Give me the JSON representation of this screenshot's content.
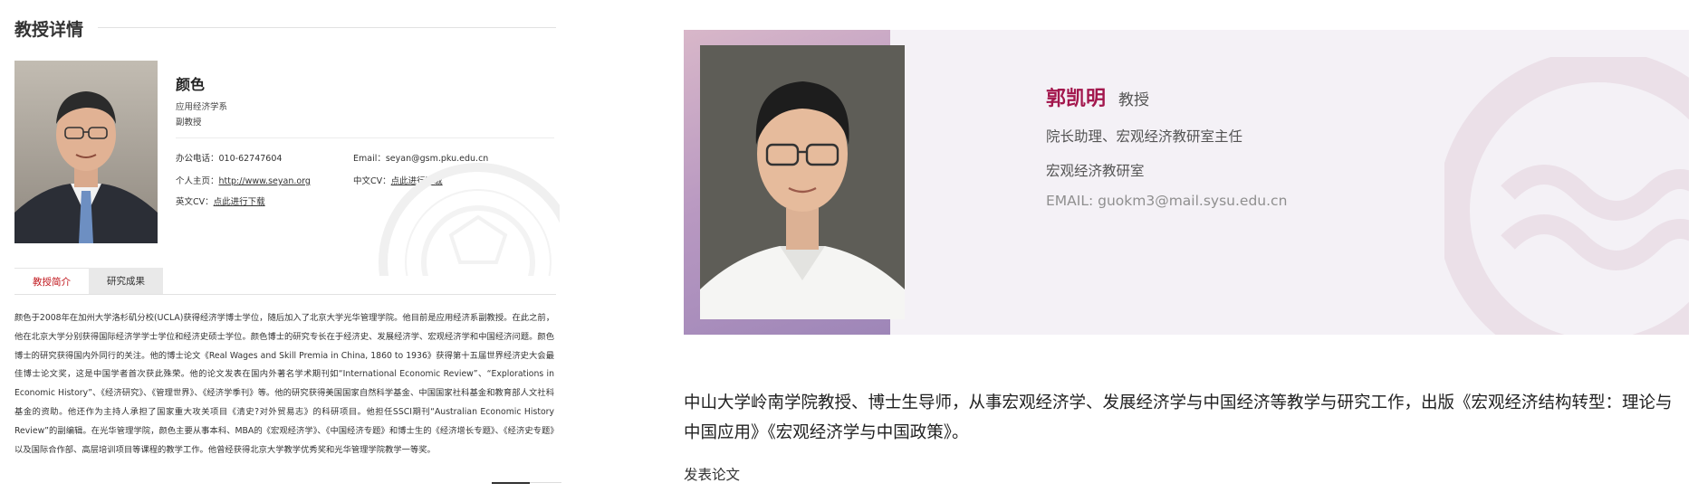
{
  "left": {
    "section_title": "教授详情",
    "professor": {
      "name": "颜色",
      "department": "应用经济学系",
      "title": "副教授"
    },
    "contact": {
      "phone_label": "办公电话：",
      "phone": "010-62747604",
      "email_label": "Email：",
      "email": "seyan@gsm.pku.edu.cn",
      "homepage_label": "个人主页：",
      "homepage": "http://www.seyan.org",
      "cv_cn_label": "中文CV：",
      "cv_cn_link": "点此进行下载",
      "cv_en_label": "英文CV：",
      "cv_en_link": "点此进行下载"
    },
    "tabs": [
      "教授简介",
      "研究成果"
    ],
    "bio": "颜色于2008年在加州大学洛杉矶分校(UCLA)获得经济学博士学位，随后加入了北京大学光华管理学院。他目前是应用经济系副教授。在此之前，他在北京大学分别获得国际经济学学士学位和经济史硕士学位。颜色博士的研究专长在于经济史、发展经济学、宏观经济学和中国经济问题。颜色博士的研究获得国内外同行的关注。他的博士论文《Real Wages and Skill Premia in China, 1860 to 1936》获得第十五届世界经济史大会最佳博士论文奖，这是中国学者首次获此殊荣。他的论文发表在国内外著名学术期刊如“International Economic Review”、“Explorations in Economic History”、《经济研究》、《管理世界》、《经济学季刊》等。他的研究获得美国国家自然科学基金、中国国家社科基金和教育部人文社科基金的资助。他还作为主持人承担了国家重大攻关项目《清史?对外贸易志》的科研项目。他担任SSCI期刊“Australian Economic History Review”的副编辑。在光华管理学院，颜色主要从事本科、MBA的《宏观经济学》、《中国经济专题》和博士生的《经济增长专题》、《经济史专题》以及国际合作部、高层培训项目等课程的教学工作。他曾经获得北京大学教学优秀奖和光华管理学院教学一等奖。"
  },
  "right": {
    "name": "郭凯明",
    "rank": "教授",
    "position": "院长助理、宏观经济教研室主任",
    "office": "宏观经济教研室",
    "email": "EMAIL: guokm3@mail.sysu.edu.cn",
    "intro": "中山大学岭南学院教授、博士生导师，从事宏观经济学、发展经济学与中国经济等教学与研究工作，出版《宏观经济结构转型：理论与中国应用》《宏观经济学与中国政策》。",
    "papers_heading": "发表论文"
  },
  "colors": {
    "accent_red": "#c0161c",
    "name_magenta": "#a3174d",
    "banner_bg": "#f4f1f6"
  }
}
